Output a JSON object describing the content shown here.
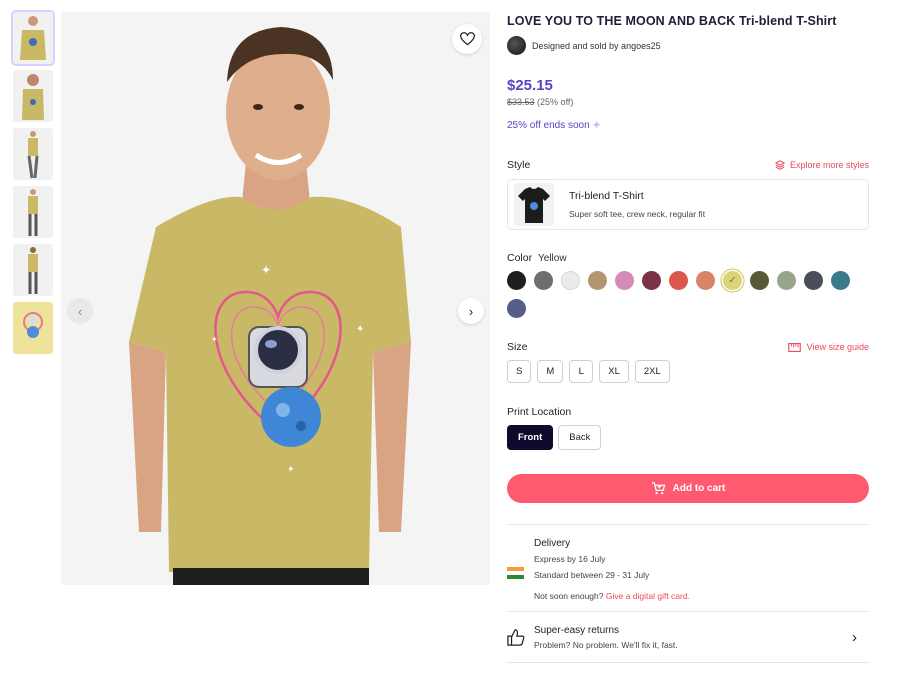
{
  "product": {
    "title": "LOVE YOU TO THE MOON AND BACK Tri-blend T-Shirt",
    "designer_text": "Designed and sold by angoes25",
    "price": "$25.15",
    "old_price": "$33.53",
    "discount": "(25% off)",
    "promo": "25% off ends soon"
  },
  "style": {
    "label": "Style",
    "explore_link": "Explore more styles",
    "name": "Tri-blend T-Shirt",
    "description": "Super soft tee, crew neck, regular fit"
  },
  "color": {
    "label": "Color",
    "selected": "Yellow",
    "swatches": [
      "#1f1f1f",
      "#6e6e6e",
      "#ebebeb",
      "#b39572",
      "#d48bb5",
      "#7a3447",
      "#d9574b",
      "#d98468",
      "#dcd27a",
      "#595838",
      "#98a48c",
      "#4a4c5c",
      "#3b7a8c",
      "#565c8c"
    ],
    "selected_index": 8
  },
  "size": {
    "label": "Size",
    "guide_link": "View size guide",
    "options": [
      "S",
      "M",
      "L",
      "XL",
      "2XL"
    ]
  },
  "print_location": {
    "label": "Print Location",
    "options": [
      "Front",
      "Back"
    ],
    "selected": "Front"
  },
  "cart": {
    "label": "Add to cart"
  },
  "delivery": {
    "title": "Delivery",
    "express": "Express by 16 July",
    "standard": "Standard between 29 - 31 July",
    "note": "Not soon enough?",
    "gift_link": "Give a digital gift card."
  },
  "returns": {
    "title": "Super-easy returns",
    "description": "Problem? No problem. We'll fix it, fast."
  },
  "colors": {
    "accent": "#5a43c9",
    "cta": "#ff5a6f",
    "link": "#e84a5f",
    "shirt": "#c9b865"
  }
}
